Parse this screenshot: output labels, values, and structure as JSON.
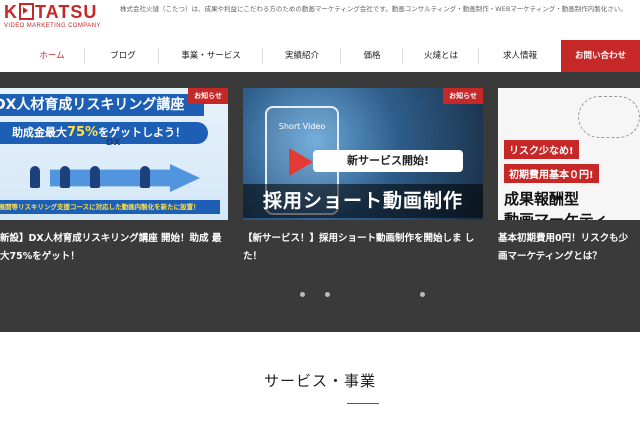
{
  "brand": {
    "logo_text_left": "K",
    "logo_text_right": "TATSU",
    "logo_sub": "VIDEO MARKETING COMPANY",
    "tagline": "株式会社火燵（こたつ）は、成果や利益にこだわる方のための動画マーケティング会社です。動画コンサルティング・動画制作・WEBマーケティング・動画制作内製化さい。",
    "accent": "#c62828"
  },
  "nav": {
    "items": [
      {
        "label": "ホーム",
        "active": true
      },
      {
        "label": "ブログ",
        "active": false
      },
      {
        "label": "事業・サービス",
        "active": false
      },
      {
        "label": "実績紹介",
        "active": false
      },
      {
        "label": "価格",
        "active": false
      },
      {
        "label": "火燵とは",
        "active": false
      },
      {
        "label": "求人情報",
        "active": false
      }
    ],
    "cta": "お問い合わせ"
  },
  "slider": {
    "cards": [
      {
        "badge": "お知らせ",
        "title": "新設】DX人材育成リスキリング講座 開始！助成 最大75%をゲット！",
        "img": {
          "headline_1": "DX人材育成リスキリング講座",
          "headline_2": "助成金最大",
          "headline_3": "75%",
          "headline_4": "をゲットしよう！",
          "strip": "業展開等リスキリング支援コースに対応した動画内製化を新たに設置！",
          "tag": "DX"
        }
      },
      {
        "badge": "お知らせ",
        "title": "【新サービス！】採用ショート動画制作を開始しま した！",
        "img": {
          "phone_label": "Short Video",
          "tag": "新サービス開始!",
          "big": "採用ショート動画制作"
        }
      },
      {
        "badge": "",
        "title": "基本初期費用0円！リスクも少 画マーケティングとは？",
        "img": {
          "line1": "リスク少なめ!",
          "line2": "初期費用基本０円!",
          "big1": "成果報酬型",
          "big2": "動画マーケティ"
        }
      }
    ]
  },
  "section": {
    "title": "サービス・事業"
  }
}
